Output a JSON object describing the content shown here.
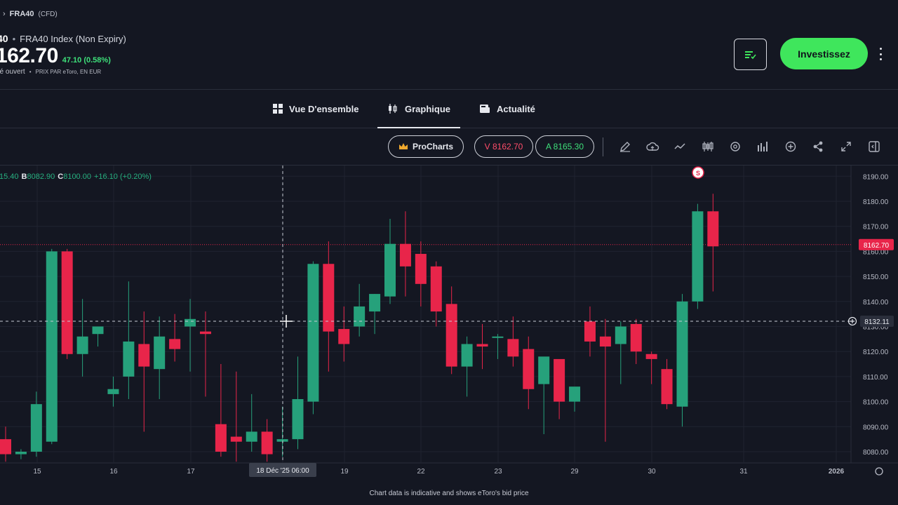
{
  "header": {
    "breadcrumb_symbol": "FRA40",
    "breadcrumb_tag": "(CFD)",
    "symbol": "40",
    "instrument_name": "FRA40 Index (Non Expiry)",
    "price": "162.70",
    "change": "47.10 (0.58%)",
    "market_status": "hé ouvert",
    "price_note": "PRIX PAR eToro, EN EUR",
    "invest_label": "Investissez"
  },
  "tabs": [
    {
      "label": "Vue D'ensemble",
      "icon": "grid-icon"
    },
    {
      "label": "Graphique",
      "icon": "candlestick-icon",
      "active": true
    },
    {
      "label": "Actualité",
      "icon": "news-icon"
    }
  ],
  "toolbar": {
    "prochart_label": "ProCharts",
    "sell_label": "V 8162.70",
    "buy_label": "A 8165.30",
    "tools": [
      "pencil-icon",
      "cloud-icon",
      "line-chart-icon",
      "candles-icon",
      "settings-icon",
      "bar-chart-icon",
      "plus-circle-icon",
      "share-icon",
      "expand-icon",
      "panel-icon"
    ]
  },
  "ohlc": {
    "o": "15.40",
    "b_label": "B",
    "b": "8082.90",
    "c_label": "C",
    "c": "8100.00",
    "change": "+16.10 (+0.20%)"
  },
  "chart_data": {
    "type": "candlestick",
    "y_ticks": [
      8080,
      8090,
      8100,
      8110,
      8120,
      8130,
      8140,
      8150,
      8160,
      8170,
      8180,
      8190
    ],
    "ylim": [
      8076,
      8194
    ],
    "x_labels": [
      "15",
      "16",
      "17",
      "18 Déc '25  06:00",
      "19",
      "22",
      "23",
      "29",
      "30",
      "31",
      "2026"
    ],
    "current_price": "8162.70",
    "crosshair_price": "8132.11",
    "crosshair_time": "18 Déc '25  06:00",
    "marker_label": "S",
    "grid": true,
    "colors": {
      "up": "#26a17b",
      "down": "#e8254a",
      "background": "#141722"
    },
    "candles": [
      {
        "o": 8085,
        "h": 8090,
        "l": 8076,
        "c": 8079
      },
      {
        "o": 8079,
        "h": 8081,
        "l": 8077,
        "c": 8080
      },
      {
        "o": 8080,
        "h": 8104,
        "l": 8078,
        "c": 8099
      },
      {
        "o": 8084,
        "h": 8161,
        "l": 8083,
        "c": 8160
      },
      {
        "o": 8160,
        "h": 8161,
        "l": 8117,
        "c": 8119
      },
      {
        "o": 8119,
        "h": 8141,
        "l": 8110,
        "c": 8126
      },
      {
        "o": 8127,
        "h": 8130,
        "l": 8122,
        "c": 8130
      },
      {
        "o": 8103,
        "h": 8110,
        "l": 8098,
        "c": 8105
      },
      {
        "o": 8110,
        "h": 8148,
        "l": 8101,
        "c": 8124
      },
      {
        "o": 8123,
        "h": 8136,
        "l": 8088,
        "c": 8114
      },
      {
        "o": 8113,
        "h": 8134,
        "l": 8101,
        "c": 8126
      },
      {
        "o": 8125,
        "h": 8135,
        "l": 8116,
        "c": 8121
      },
      {
        "o": 8130,
        "h": 8141,
        "l": 8112,
        "c": 8133
      },
      {
        "o": 8128,
        "h": 8136,
        "l": 8102,
        "c": 8127
      },
      {
        "o": 8091,
        "h": 8115,
        "l": 8078,
        "c": 8080
      },
      {
        "o": 8086,
        "h": 8112,
        "l": 8076,
        "c": 8084
      },
      {
        "o": 8084,
        "h": 8103,
        "l": 8080,
        "c": 8088
      },
      {
        "o": 8088,
        "h": 8093,
        "l": 8076,
        "c": 8079
      },
      {
        "o": 8084,
        "h": 8098,
        "l": 8078,
        "c": 8085
      },
      {
        "o": 8085,
        "h": 8118,
        "l": 8081,
        "c": 8101
      },
      {
        "o": 8100,
        "h": 8156,
        "l": 8095,
        "c": 8155
      },
      {
        "o": 8155,
        "h": 8164,
        "l": 8112,
        "c": 8128
      },
      {
        "o": 8129,
        "h": 8138,
        "l": 8116,
        "c": 8123
      },
      {
        "o": 8130,
        "h": 8147,
        "l": 8126,
        "c": 8138
      },
      {
        "o": 8136,
        "h": 8143,
        "l": 8127,
        "c": 8143
      },
      {
        "o": 8142,
        "h": 8173,
        "l": 8139,
        "c": 8163
      },
      {
        "o": 8163,
        "h": 8176,
        "l": 8142,
        "c": 8154
      },
      {
        "o": 8159,
        "h": 8164,
        "l": 8138,
        "c": 8147
      },
      {
        "o": 8154,
        "h": 8156,
        "l": 8130,
        "c": 8136
      },
      {
        "o": 8139,
        "h": 8146,
        "l": 8111,
        "c": 8114
      },
      {
        "o": 8114,
        "h": 8126,
        "l": 8102,
        "c": 8123
      },
      {
        "o": 8123,
        "h": 8131,
        "l": 8113,
        "c": 8122
      },
      {
        "o": 8126,
        "h": 8127,
        "l": 8117,
        "c": 8126
      },
      {
        "o": 8125,
        "h": 8134,
        "l": 8114,
        "c": 8118
      },
      {
        "o": 8121,
        "h": 8126,
        "l": 8097,
        "c": 8105
      },
      {
        "o": 8107,
        "h": 8114,
        "l": 8087,
        "c": 8118
      },
      {
        "o": 8117,
        "h": 8116,
        "l": 8093,
        "c": 8100
      },
      {
        "o": 8100,
        "h": 8104,
        "l": 8096,
        "c": 8106
      },
      {
        "o": 8132,
        "h": 8138,
        "l": 8118,
        "c": 8124
      },
      {
        "o": 8126,
        "h": 8133,
        "l": 8084,
        "c": 8122
      },
      {
        "o": 8123,
        "h": 8132,
        "l": 8107,
        "c": 8130
      },
      {
        "o": 8131,
        "h": 8133,
        "l": 8115,
        "c": 8120
      },
      {
        "o": 8119,
        "h": 8120,
        "l": 8107,
        "c": 8117
      },
      {
        "o": 8113,
        "h": 8117,
        "l": 8097,
        "c": 8099
      },
      {
        "o": 8098,
        "h": 8143,
        "l": 8090,
        "c": 8140
      },
      {
        "o": 8140,
        "h": 8179,
        "l": 8137,
        "c": 8176
      },
      {
        "o": 8176,
        "h": 8183,
        "l": 8144,
        "c": 8162
      }
    ]
  },
  "footer": {
    "note": "Chart data is indicative and shows eToro's bid price"
  }
}
